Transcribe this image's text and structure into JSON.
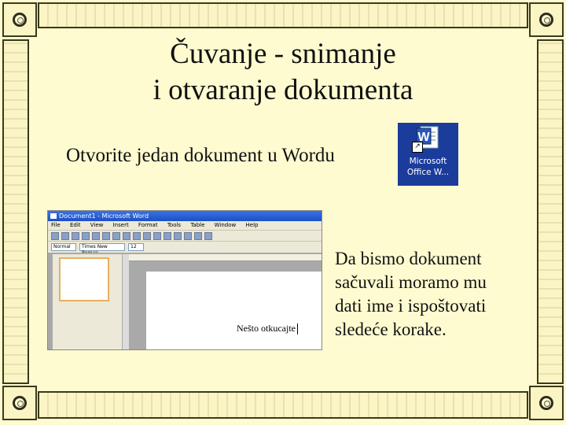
{
  "slide": {
    "title_line1": "Čuvanje - snimanje",
    "title_line2": "i otvaranje dokumenta",
    "subtitle": "Otvorite jedan dokument u Wordu",
    "paragraph": [
      "Da bismo dokument",
      "sačuvali moramo mu",
      "dati ime i ispoštovati",
      "sledeće korake."
    ]
  },
  "desktop_icon": {
    "label_line1": "Microsoft",
    "label_line2": "Office W...",
    "glyph": "W",
    "icon": "word-icon"
  },
  "word_window": {
    "title": "Document1 - Microsoft Word",
    "menu": [
      "File",
      "Edit",
      "View",
      "Insert",
      "Format",
      "Tools",
      "Table",
      "Window",
      "Help"
    ],
    "style_box": "Normal",
    "font_box": "Times New Roman",
    "size_box": "12",
    "document_text": "Nešto otkucajte"
  },
  "colors": {
    "background": "#fffbd0",
    "frame": "#fbf5c6",
    "icon_bg": "#1c3c9c",
    "titlebar": "#1c4fc7"
  }
}
